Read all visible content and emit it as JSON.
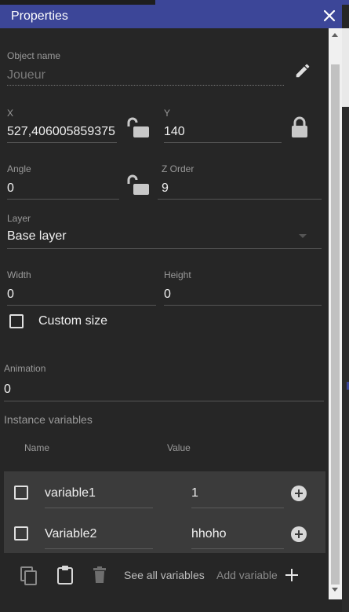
{
  "panel": {
    "title": "Properties"
  },
  "object_name": {
    "label": "Object name",
    "placeholder": "Joueur"
  },
  "position": {
    "x_label": "X",
    "x_value": "527,406005859375",
    "y_label": "Y",
    "y_value": "140"
  },
  "rotation": {
    "angle_label": "Angle",
    "angle_value": "0",
    "zorder_label": "Z Order",
    "zorder_value": "9"
  },
  "layer": {
    "label": "Layer",
    "value": "Base layer"
  },
  "size": {
    "width_label": "Width",
    "width_value": "0",
    "height_label": "Height",
    "height_value": "0",
    "custom_size_label": "Custom size"
  },
  "animation": {
    "label": "Animation",
    "value": "0"
  },
  "instance_variables": {
    "heading": "Instance variables",
    "col_name": "Name",
    "col_value": "Value",
    "rows": [
      {
        "name": "variable1",
        "value": "1"
      },
      {
        "name": "Variable2",
        "value": "hhoho"
      }
    ]
  },
  "footer": {
    "see_all": "See all variables",
    "add_variable": "Add variable"
  },
  "icons": {
    "close": "close-icon",
    "edit": "pencil-icon",
    "lock_open": "lock-open-icon",
    "lock_closed": "lock-icon",
    "copy": "copy-icon",
    "paste": "paste-icon",
    "delete": "trash-icon",
    "add": "plus-icon"
  },
  "colors": {
    "accent": "#3c4698",
    "background": "#262626",
    "table_bg": "#3b3b3b"
  }
}
